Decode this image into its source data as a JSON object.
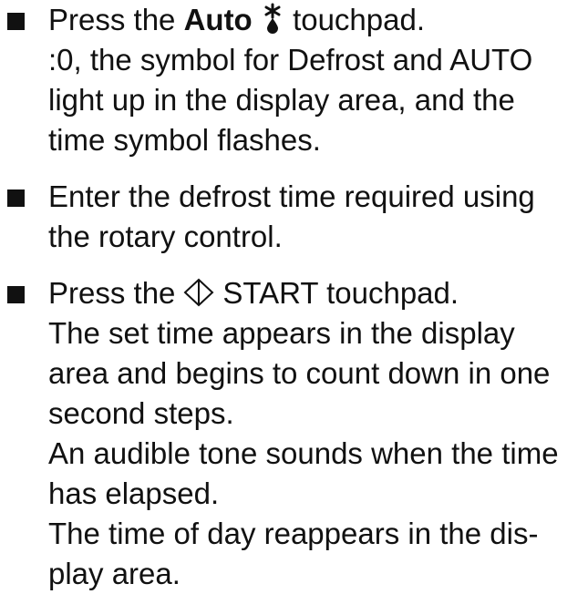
{
  "steps": [
    {
      "first_line": {
        "prefix": "Press the",
        "bold": "Auto",
        "icon": "defrost-snowflake-drop-icon",
        "suffix": "touchpad."
      },
      "lines": [
        ":0, the symbol for Defrost and AUTO",
        "light up in the display area, and the",
        "time symbol flashes."
      ]
    },
    {
      "lines": [
        "Enter the defrost time required using",
        "the rotary control."
      ]
    },
    {
      "first_line": {
        "prefix": "Press the",
        "icon": "start-diamond-icon",
        "suffix": "START touchpad."
      },
      "lines": [
        "The set time appears in the display",
        "area and begins to count down in one",
        "second steps.",
        "An audible tone sounds when the time",
        "has elapsed.",
        "The time of day reappears in the dis-",
        "play area."
      ]
    }
  ]
}
